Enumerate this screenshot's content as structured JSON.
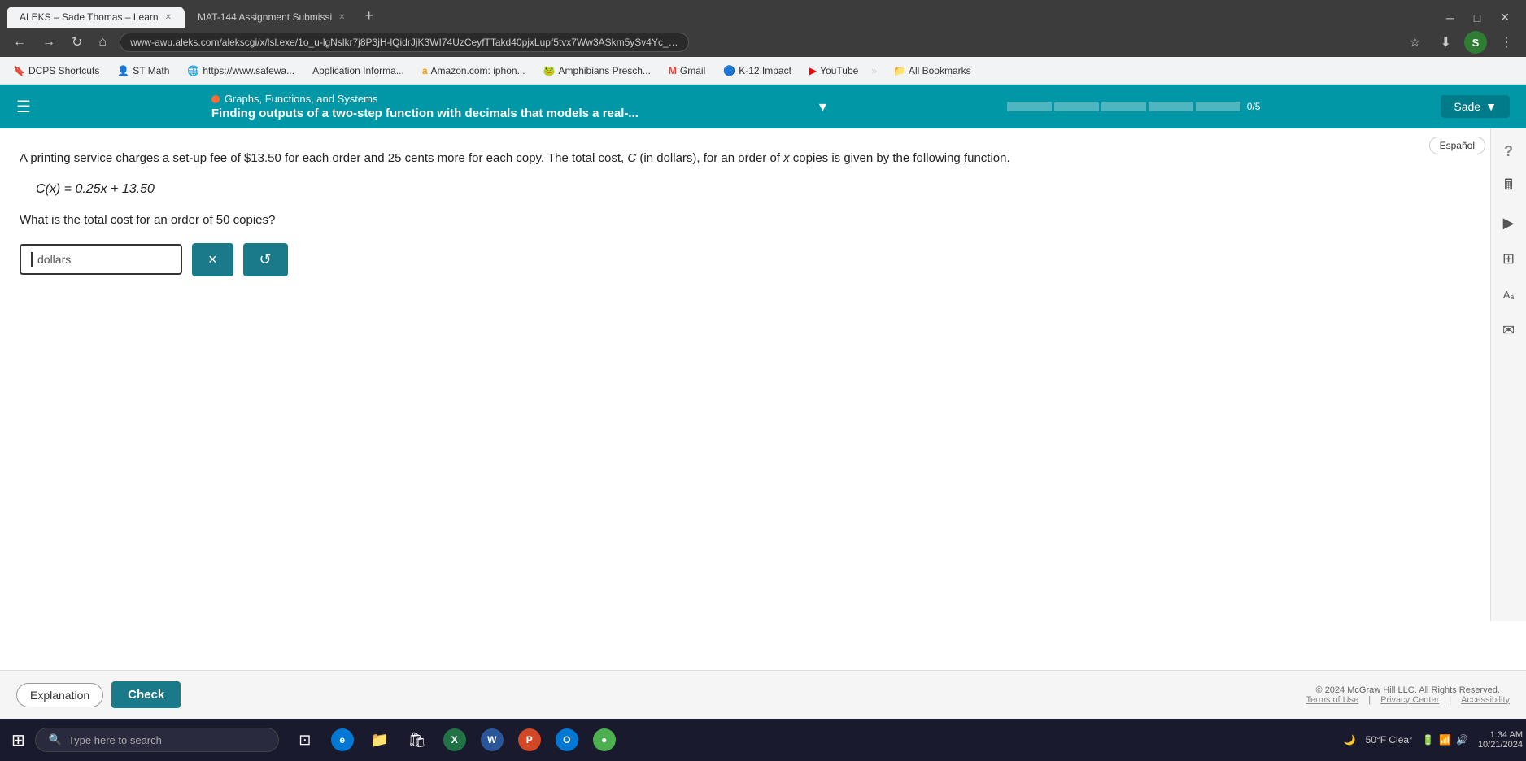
{
  "browser": {
    "tabs": [
      {
        "id": "aleks",
        "label": "ALEKS – Sade Thomas – Learn",
        "active": true
      },
      {
        "id": "mat144",
        "label": "MAT-144 Assignment Submissi",
        "active": false
      }
    ],
    "address": "www-awu.aleks.com/alekscgi/x/lsl.exe/1o_u-lgNslkr7j8P3jH-lQidrJjK3WI74UzCeyfTTakd40pjxLupf5tvx7Ww3ASkm5ySv4Yc_mkWXWlzOgDcB...",
    "new_tab_icon": "+"
  },
  "bookmarks": [
    {
      "id": "dcps",
      "label": "DCPS Shortcuts",
      "icon": "🔖"
    },
    {
      "id": "stmath",
      "label": "ST Math",
      "icon": "👤"
    },
    {
      "id": "safewa",
      "label": "https://www.safewa...",
      "icon": "🌐"
    },
    {
      "id": "appinfo",
      "label": "Application Informa...",
      "icon": ""
    },
    {
      "id": "amazon",
      "label": "Amazon.com: iphon...",
      "icon": "a"
    },
    {
      "id": "amphibians",
      "label": "Amphibians Presch...",
      "icon": "🐸"
    },
    {
      "id": "gmail",
      "label": "Gmail",
      "icon": "M"
    },
    {
      "id": "k12",
      "label": "K-12 Impact",
      "icon": "🔵"
    },
    {
      "id": "youtube",
      "label": "YouTube",
      "icon": "▶"
    },
    {
      "id": "allbookmarks",
      "label": "All Bookmarks",
      "icon": "📁"
    }
  ],
  "aleks": {
    "header": {
      "menu_label": "☰",
      "category": "Graphs, Functions, and Systems",
      "title": "Finding outputs of a two-step function with decimals that models a real-...",
      "progress": {
        "filled": 0,
        "total": 5,
        "text": "0/5"
      },
      "user_label": "Sade",
      "chevron": "▼",
      "collapse": "▲",
      "espanol_label": "Español"
    },
    "problem": {
      "text_part1": "A printing service charges a set-up fee of $13.50 for each order and 25 cents more for each copy. The total cost,",
      "text_italic": "C",
      "text_part2": "(in dollars), for an order of",
      "text_x": "x",
      "text_part3": "copies is given by the following",
      "text_underline": "function",
      "text_period": ".",
      "formula": "C(x) = 0.25x + 13.50",
      "question": "What is the total cost for an order of 50 copies?",
      "answer_placeholder": "",
      "answer_unit": "dollars"
    },
    "buttons": {
      "clear_label": "×",
      "reset_label": "↺",
      "explanation_label": "Explanation",
      "check_label": "Check"
    },
    "footer": {
      "copyright": "© 2024 McGraw Hill LLC. All Rights Reserved.",
      "terms_label": "Terms of Use",
      "privacy_label": "Privacy Center",
      "accessibility_label": "Accessibility"
    },
    "sidebar_tools": [
      {
        "id": "help",
        "icon": "?",
        "label": "help-icon"
      },
      {
        "id": "calculator",
        "icon": "🖩",
        "label": "calculator-icon"
      },
      {
        "id": "video",
        "icon": "▶",
        "label": "video-icon"
      },
      {
        "id": "grid",
        "icon": "⊞",
        "label": "grid-icon"
      },
      {
        "id": "text",
        "icon": "Aₐ",
        "label": "text-icon"
      },
      {
        "id": "envelope",
        "icon": "✉",
        "label": "envelope-icon"
      }
    ]
  },
  "taskbar": {
    "start_icon": "⊞",
    "search_placeholder": "Type here to search",
    "search_icon": "🔍",
    "apps": [
      {
        "id": "taskview",
        "icon": "⊡",
        "label": "task-view-icon"
      },
      {
        "id": "edge",
        "icon": "e",
        "label": "edge-icon",
        "color": "#0078d4"
      },
      {
        "id": "files",
        "icon": "📁",
        "label": "files-icon",
        "color": "#f4a825"
      },
      {
        "id": "store",
        "icon": "🛍",
        "label": "store-icon",
        "color": "#0078d4"
      },
      {
        "id": "excel",
        "icon": "X",
        "label": "excel-icon",
        "color": "#217346"
      },
      {
        "id": "word",
        "icon": "W",
        "label": "word-icon",
        "color": "#2b579a"
      },
      {
        "id": "powerpoint",
        "icon": "P",
        "label": "powerpoint-icon",
        "color": "#d24726"
      },
      {
        "id": "outlook",
        "icon": "O",
        "label": "outlook-icon",
        "color": "#0078d4"
      },
      {
        "id": "chrome",
        "icon": "●",
        "label": "chrome-icon",
        "color": "#4caf50"
      }
    ],
    "system": {
      "time": "1:34 AM",
      "date": "10/21/2024",
      "temp": "50°F Clear",
      "battery_icon": "🔋",
      "wifi_icon": "📶",
      "volume_icon": "🔊"
    }
  }
}
